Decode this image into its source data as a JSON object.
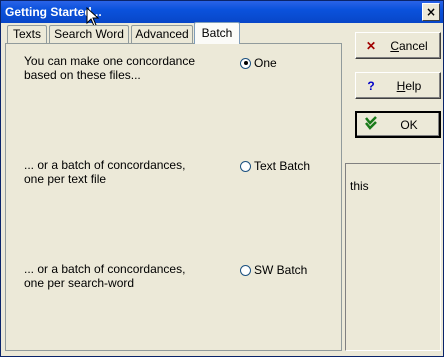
{
  "window": {
    "title": "Getting Started..."
  },
  "titlebar": {
    "close_glyph": "×"
  },
  "tabs": [
    {
      "label": "Texts"
    },
    {
      "label": "Search Word"
    },
    {
      "label": "Advanced"
    },
    {
      "label": "Batch"
    }
  ],
  "batch": {
    "one_label_line1": "You can make one concordance",
    "one_label_line2": "based on these files...",
    "one_option": "One",
    "text_label_line1": "... or a batch of concordances,",
    "text_label_line2": "one per text file",
    "text_option": "Text Batch",
    "sw_label_line1": "... or a batch of concordances,",
    "sw_label_line2": "one per search-word",
    "sw_option": "SW Batch",
    "selected": "One"
  },
  "buttons": {
    "cancel": {
      "label_ul": "C",
      "label_rest": "ancel",
      "icon": "x-icon"
    },
    "help": {
      "label_ul": "H",
      "label_rest": "elp",
      "icon": "question-icon"
    },
    "ok": {
      "label": "OK",
      "icon": "double-check-icon"
    }
  },
  "side_panel": {
    "text": "this"
  },
  "colors": {
    "title_bar": "#0a52dc",
    "face": "#ece9d8"
  }
}
